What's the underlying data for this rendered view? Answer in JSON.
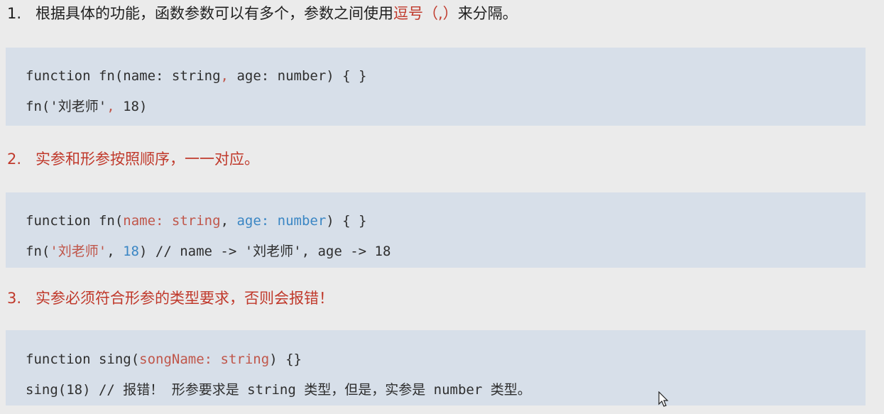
{
  "item1": {
    "number": "1.",
    "text": "根据具体的功能，函数参数可以有多个，参数之间使用",
    "highlight": "逗号（,）",
    "tail": "来分隔。"
  },
  "code1": {
    "line1": {
      "a": "function fn(name: string",
      "comma": ",",
      "b": " age: number) { }"
    },
    "line2": {
      "a": "fn('刘老师'",
      "comma": ",",
      "b": " 18)"
    }
  },
  "item2": {
    "number": "2.",
    "text": "实参和形参按照顺序，一一对应。"
  },
  "code2": {
    "line1": {
      "a": "function fn(",
      "red": "name: string",
      "mid": ", ",
      "blue": "age: number",
      "b": ") { }"
    },
    "line2": {
      "a": "fn(",
      "red": "'刘老师'",
      "mid": ", ",
      "blue": "18",
      "b": ") // name -> '刘老师', age -> 18"
    }
  },
  "item3": {
    "number": "3.",
    "text": "实参必须符合形参的类型要求，否则会报错！"
  },
  "code3": {
    "line1": {
      "a": "function sing(",
      "red": "songName: string",
      "b": ") {}"
    },
    "line2": {
      "a": "sing(18) // 报错！ 形参要求是 string 类型，但是，实参是 number 类型。"
    }
  },
  "colors": {
    "background": "#ebebeb",
    "code_background": "#d7dfe9",
    "accent_red": "#c0392b",
    "param_red": "#c0564a",
    "param_blue": "#3a86c4"
  },
  "icons": [
    "mouse-pointer-icon"
  ]
}
